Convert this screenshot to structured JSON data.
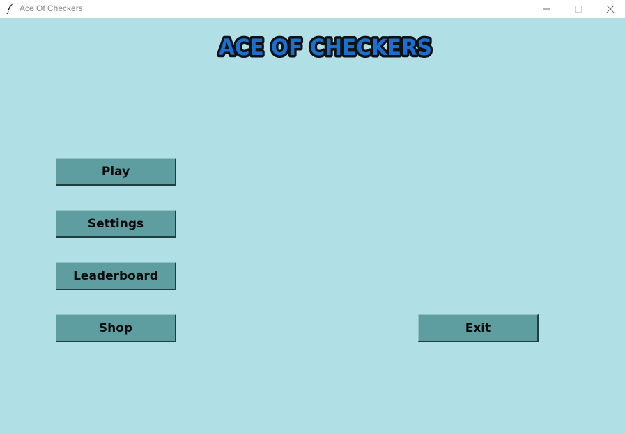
{
  "window": {
    "title": "Ace Of Checkers",
    "icon": "feather-icon",
    "controls": [
      "minimize-icon",
      "maximize-icon",
      "close-icon"
    ]
  },
  "logo": {
    "text": "ACE OF CHECKERS"
  },
  "menu": {
    "play_label": "Play",
    "settings_label": "Settings",
    "leaderboard_label": "Leaderboard",
    "shop_label": "Shop",
    "exit_label": "Exit"
  },
  "colors": {
    "background": "#b0dfe5",
    "button": "#5f9ea0",
    "logo_fill": "#1a6fd0",
    "logo_outline": "#111111"
  }
}
